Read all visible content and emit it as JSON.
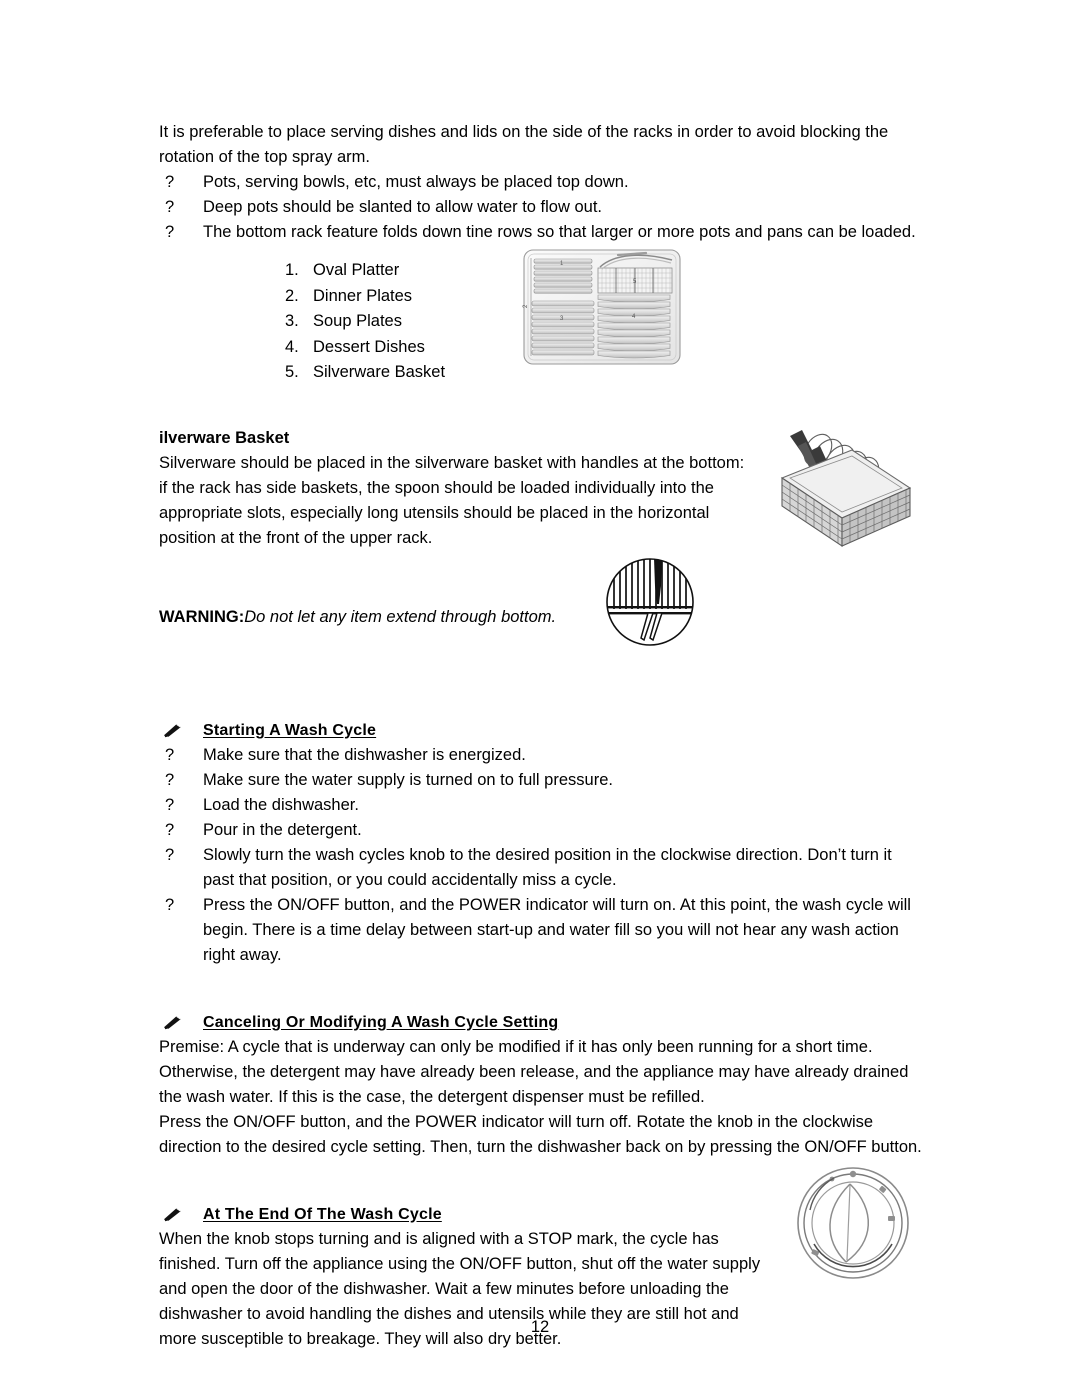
{
  "document": {
    "page_number": "12",
    "intro_paragraph": "It is preferable to place serving dishes and lids on the side of the racks in order to avoid blocking the rotation of the top spray arm.",
    "intro_bullets": [
      {
        "marker": "?",
        "text": "Pots, serving bowls, etc, must always be placed top down."
      },
      {
        "marker": "?",
        "text": "Deep pots should be slanted to allow water to flow out."
      },
      {
        "marker": "?",
        "text": "The bottom rack feature folds down tine rows so that larger or more pots and pans can be loaded."
      }
    ],
    "rack_legend": [
      {
        "num": "1.",
        "label": "Oval Platter"
      },
      {
        "num": "2.",
        "label": "Dinner Plates"
      },
      {
        "num": "3.",
        "label": "Soup Plates"
      },
      {
        "num": "4.",
        "label": "Dessert Dishes"
      },
      {
        "num": "5.",
        "label": "Silverware Basket"
      }
    ],
    "rack_figure": {
      "name": "dishwasher-rack-diagram",
      "callouts": [
        "1",
        "2",
        "3",
        "4",
        "5"
      ]
    },
    "silverware_section": {
      "heading": "ilverware Basket",
      "body": "Silverware should be placed in the silverware basket with handles at the bottom: if the rack has side baskets, the spoon should be loaded individually into the appropriate slots, especially long utensils should be placed in the horizontal position at the front of the upper rack.",
      "figure_name": "silverware-basket-illustration"
    },
    "warning": {
      "label": "WARNING:",
      "text": "Do not let any item extend through bottom.",
      "figure_name": "utensil-through-basket-bottom-illustration"
    },
    "sections": [
      {
        "marker": "pencil-icon",
        "heading": "Starting A Wash Cycle",
        "bullets": [
          {
            "marker": "?",
            "text": "Make sure that the dishwasher is energized."
          },
          {
            "marker": "?",
            "text": "Make sure the water supply is turned on to full pressure."
          },
          {
            "marker": "?",
            "text": "Load the dishwasher."
          },
          {
            "marker": "?",
            "text": "Pour in the detergent."
          },
          {
            "marker": "?",
            "text": "Slowly turn the wash cycles knob to the desired position in the clockwise direction. Don’t turn it past that position, or you could accidentally miss a cycle."
          },
          {
            "marker": "?",
            "text": "Press the ON/OFF button, and the POWER indicator will turn on. At this point, the wash cycle will begin. There is a time delay between start-up and water fill so you will not hear any wash action right away."
          }
        ]
      },
      {
        "marker": "pencil-icon",
        "heading": "Canceling Or Modifying A Wash Cycle Setting",
        "paragraphs": [
          "Premise: A cycle that is underway can only be modified if it has only been running for a short time. Otherwise, the detergent may have already been release, and the appliance may have already drained the wash water. If this is the case, the detergent dispenser must be refilled.",
          "Press the ON/OFF button, and the POWER indicator will turn off. Rotate the knob in the clockwise direction to the desired cycle setting. Then, turn the dishwasher back on by pressing the ON/OFF button."
        ]
      },
      {
        "marker": "pencil-icon",
        "heading": "At The End Of The Wash Cycle",
        "paragraphs": [
          "When the knob stops turning and is aligned with a STOP mark, the cycle has finished. Turn off the appliance using the ON/OFF button, shut off the water supply and open the door of the dishwasher. Wait a few minutes before unloading the dishwasher to avoid handling the dishes and utensils while they are still hot and more susceptible to breakage. They will also dry better."
        ],
        "figure_name": "wash-cycle-knob-illustration"
      }
    ]
  }
}
